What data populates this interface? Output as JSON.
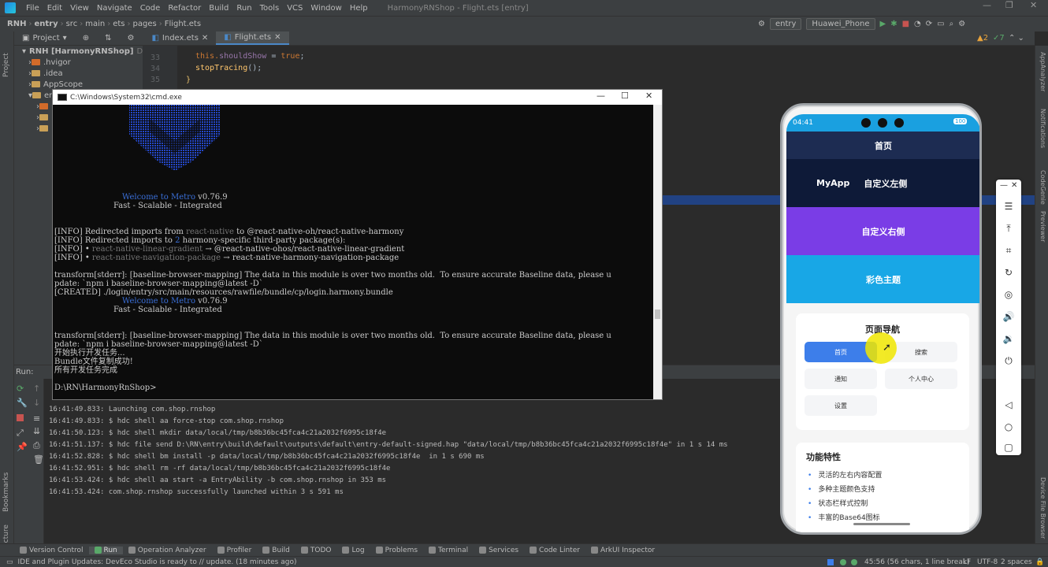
{
  "menu": {
    "items": [
      "File",
      "Edit",
      "View",
      "Navigate",
      "Code",
      "Refactor",
      "Build",
      "Run",
      "Tools",
      "VCS",
      "Window",
      "Help"
    ],
    "title": "HarmonyRNShop - Flight.ets [entry]"
  },
  "nav": {
    "crumbs": [
      "RNH",
      "entry",
      "src",
      "main",
      "ets",
      "pages",
      "Flight.ets"
    ],
    "module": "entry",
    "device": "Huawei_Phone"
  },
  "tabs": {
    "project_label": "Project",
    "files": [
      "Index.ets",
      "Flight.ets"
    ],
    "active": "Flight.ets",
    "inspect_warn": "2",
    "inspect_ok": "7"
  },
  "tree": {
    "root": "RNH [HarmonyRNShop]",
    "root_path": "D:\\RN\\",
    "items": [
      ".hvigor",
      ".idea",
      "AppScope",
      "en"
    ]
  },
  "editor": {
    "line_numbers": [
      "33",
      "34",
      "35"
    ],
    "line1_prefix": "this.",
    "line1_field": "shouldShow",
    "line1_assign": " = ",
    "line1_value": "true",
    "line1_end": ";",
    "line2_fn": "stopTracing",
    "line2_end": "();",
    "line3": "}"
  },
  "cmd": {
    "title": "C:\\Windows\\System32\\cmd.exe",
    "welcome_pre": "Welcome to ",
    "welcome_metro": "Metro",
    "version": " v0.76.9",
    "tagline": "Fast - Scalable - Integrated",
    "info1_a": "[INFO] Redirected imports from ",
    "info1_b": "react-native",
    "info1_c": " to @react-native-oh/react-native-harmony",
    "info2_a": "[INFO] Redirected imports to ",
    "info2_b": "2",
    "info2_c": " harmony-specific third-party package(s):",
    "info3_a": "[INFO] • ",
    "info3_b": "react-native-linear-gradient",
    "info3_c": " → @react-native-ohos/react-native-linear-gradient",
    "info4_a": "[INFO] • ",
    "info4_b": "react-native-navigation-package",
    "info4_c": " → react-native-harmony-navigation-package",
    "stderr1": "transform[stderr]: [baseline-browser-mapping] The data in this module is over two months old.  To ensure accurate Baseline data, please u",
    "stderr1b": "pdate: `npm i baseline-browser-mapping@latest -D`",
    "created": "[CREATED] ./login/entry/src/main/resources/rawfile/bundle/cp/login.harmony.bundle",
    "stderr2": "transform[stderr]: [baseline-browser-mapping] The data in this module is over two months old.  To ensure accurate Baseline data, please u",
    "stderr2b": "pdate: `npm i baseline-browser-mapping@latest -D`",
    "cn1": "开始执行开发任务...",
    "cn2": "Bundle文件复制成功!",
    "cn3": "所有开发任务完成",
    "prompt": "D:\\RN\\HarmonyRnShop>"
  },
  "run": {
    "label": "Run:",
    "lines": [
      "16:41:49.833: Launching com.shop.rnshop",
      "16:41:49.833: $ hdc shell aa force-stop com.shop.rnshop",
      "16:41:50.123: $ hdc shell mkdir data/local/tmp/b8b36bc45fca4c21a2032f6995c18f4e",
      "16:41:51.137: $ hdc file send D:\\RN\\entry\\build\\default\\outputs\\default\\entry-default-signed.hap \"data/local/tmp/b8b36bc45fca4c21a2032f6995c18f4e\" in 1 s 14 ms",
      "16:41:52.828: $ hdc shell bm install -p data/local/tmp/b8b36bc45fca4c21a2032f6995c18f4e  in 1 s 690 ms",
      "16:41:52.951: $ hdc shell rm -rf data/local/tmp/b8b36bc45fca4c21a2032f6995c18f4e",
      "16:41:53.424: $ hdc shell aa start -a EntryAbility -b com.shop.rnshop in 353 ms",
      "16:41:53.424: com.shop.rnshop successfully launched within 3 s 591 ms"
    ]
  },
  "bottom_tools": [
    "Version Control",
    "Run",
    "Operation Analyzer",
    "Profiler",
    "Build",
    "TODO",
    "Log",
    "Problems",
    "Terminal",
    "Services",
    "Code Linter",
    "ArkUI Inspector"
  ],
  "status": {
    "message": "IDE and Plugin Updates: DevEco Studio is ready to // update. (18 minutes ago)",
    "position": "45:56 (56 chars, 1 line break)",
    "line_sep": "LF",
    "encoding": "UTF-8",
    "indent": "2 spaces"
  },
  "side_left": [
    "Project",
    "Bookmarks",
    "Structure"
  ],
  "side_right": [
    "AppAnalyzer",
    "Notifications",
    "CodeGenie",
    "Previewer",
    "Device File Browser"
  ],
  "phone": {
    "time": "04:41",
    "battery": "100",
    "header": "首页",
    "app_name": "MyApp",
    "left_custom": "自定义左侧",
    "right_custom": "自定义右侧",
    "color_theme": "彩色主题",
    "nav_title": "页面导航",
    "nav_buttons": [
      "首页",
      "搜索",
      "通知",
      "个人中心",
      "设置"
    ],
    "features_title": "功能特性",
    "features": [
      "灵活的左右内容配置",
      "多种主题颜色支持",
      "状态栏样式控制",
      "丰富的Base64图标"
    ],
    "colors": {
      "status": "#1aa0e0",
      "header": "#1d2c52",
      "purple": "#7a3de6",
      "cyan": "#18a7e6",
      "accent": "#3d7eea"
    }
  }
}
